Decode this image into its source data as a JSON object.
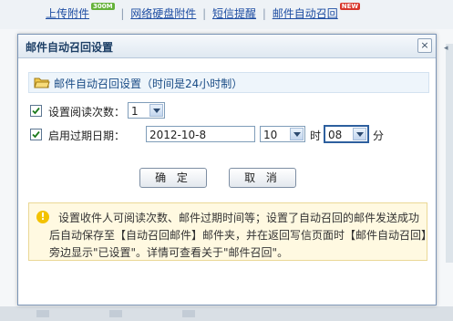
{
  "toolbar": {
    "links": [
      {
        "label": "上传附件",
        "badge": "300M",
        "badge_color": "#64b23a"
      },
      {
        "label": "网络硬盘附件"
      },
      {
        "label": "短信提醒"
      },
      {
        "label": "邮件自动召回",
        "badge": "NEW",
        "badge_color": "#d8352b"
      }
    ],
    "separator": "|"
  },
  "dialog": {
    "title": "邮件自动召回设置",
    "close_symbol": "×",
    "section_label": "邮件自动召回设置（时间是24小时制）",
    "read_limit": {
      "checked": true,
      "label": "设置阅读次数：",
      "value": "1"
    },
    "expiry": {
      "checked": true,
      "label": "启用过期日期：",
      "date": "2012-10-8",
      "hour": "10",
      "hour_unit": "时",
      "minute": "08",
      "minute_unit": "分"
    },
    "buttons": {
      "ok": "确 定",
      "cancel": "取 消"
    },
    "notice": {
      "icon": "!",
      "lines": [
        "设置收件人可阅读次数、邮件过期时间等；设置了自动召回的邮件发送成功",
        "后自动保存至【自动召回邮件】邮件夹，并在返回写信页面时【邮件自动召回】",
        "旁边显示\"已设置\"。详情可查看关于\"邮件召回\"。"
      ]
    }
  },
  "colors": {
    "title": "#1d3f66",
    "link": "#1f4ea3",
    "section_text": "#1a4c86",
    "notice_bg": "#fff9e1",
    "warning_icon": "#f3c200"
  }
}
